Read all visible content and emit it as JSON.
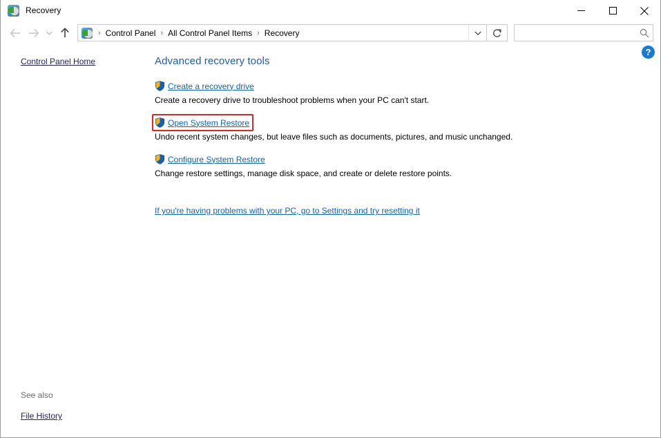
{
  "window": {
    "title": "Recovery",
    "icon": "recovery-icon",
    "controls": {
      "minimize": "Minimize",
      "maximize": "Maximize",
      "close": "Close"
    }
  },
  "addressbar": {
    "back": "Back",
    "forward": "Forward",
    "recent": "Recent locations",
    "up": "Up one level",
    "breadcrumbs": [
      "Control Panel",
      "All Control Panel Items",
      "Recovery"
    ],
    "separator": "›",
    "dropdown": "Previous locations",
    "refresh": "Refresh",
    "search": {
      "value": "",
      "placeholder": "",
      "icon": "search-icon"
    }
  },
  "sidebar": {
    "home_label": "Control Panel Home",
    "see_also_label": "See also",
    "see_also_items": [
      {
        "label": "File History"
      }
    ]
  },
  "content": {
    "help_label": "?",
    "page_title": "Advanced recovery tools",
    "tasks": [
      {
        "link": "Create a recovery drive",
        "description": "Create a recovery drive to troubleshoot problems when your PC can't start.",
        "icon": "uac-shield-icon",
        "highlighted": false,
        "hovered": false
      },
      {
        "link": "Open System Restore",
        "description": "Undo recent system changes, but leave files such as documents, pictures, and music unchanged.",
        "icon": "uac-shield-icon",
        "highlighted": true,
        "hovered": true
      },
      {
        "link": "Configure System Restore",
        "description": "Change restore settings, manage disk space, and create or delete restore points.",
        "icon": "uac-shield-icon",
        "highlighted": false,
        "hovered": false
      }
    ],
    "footer_link": "If you're having problems with your PC, go to Settings and try resetting it"
  },
  "colors": {
    "link_blue": "#0a63c9",
    "title_blue": "#1d5bb9",
    "sidebar_navy": "#1f1f6e",
    "highlight_red": "#e8231f",
    "help_blue": "#1978d2"
  }
}
